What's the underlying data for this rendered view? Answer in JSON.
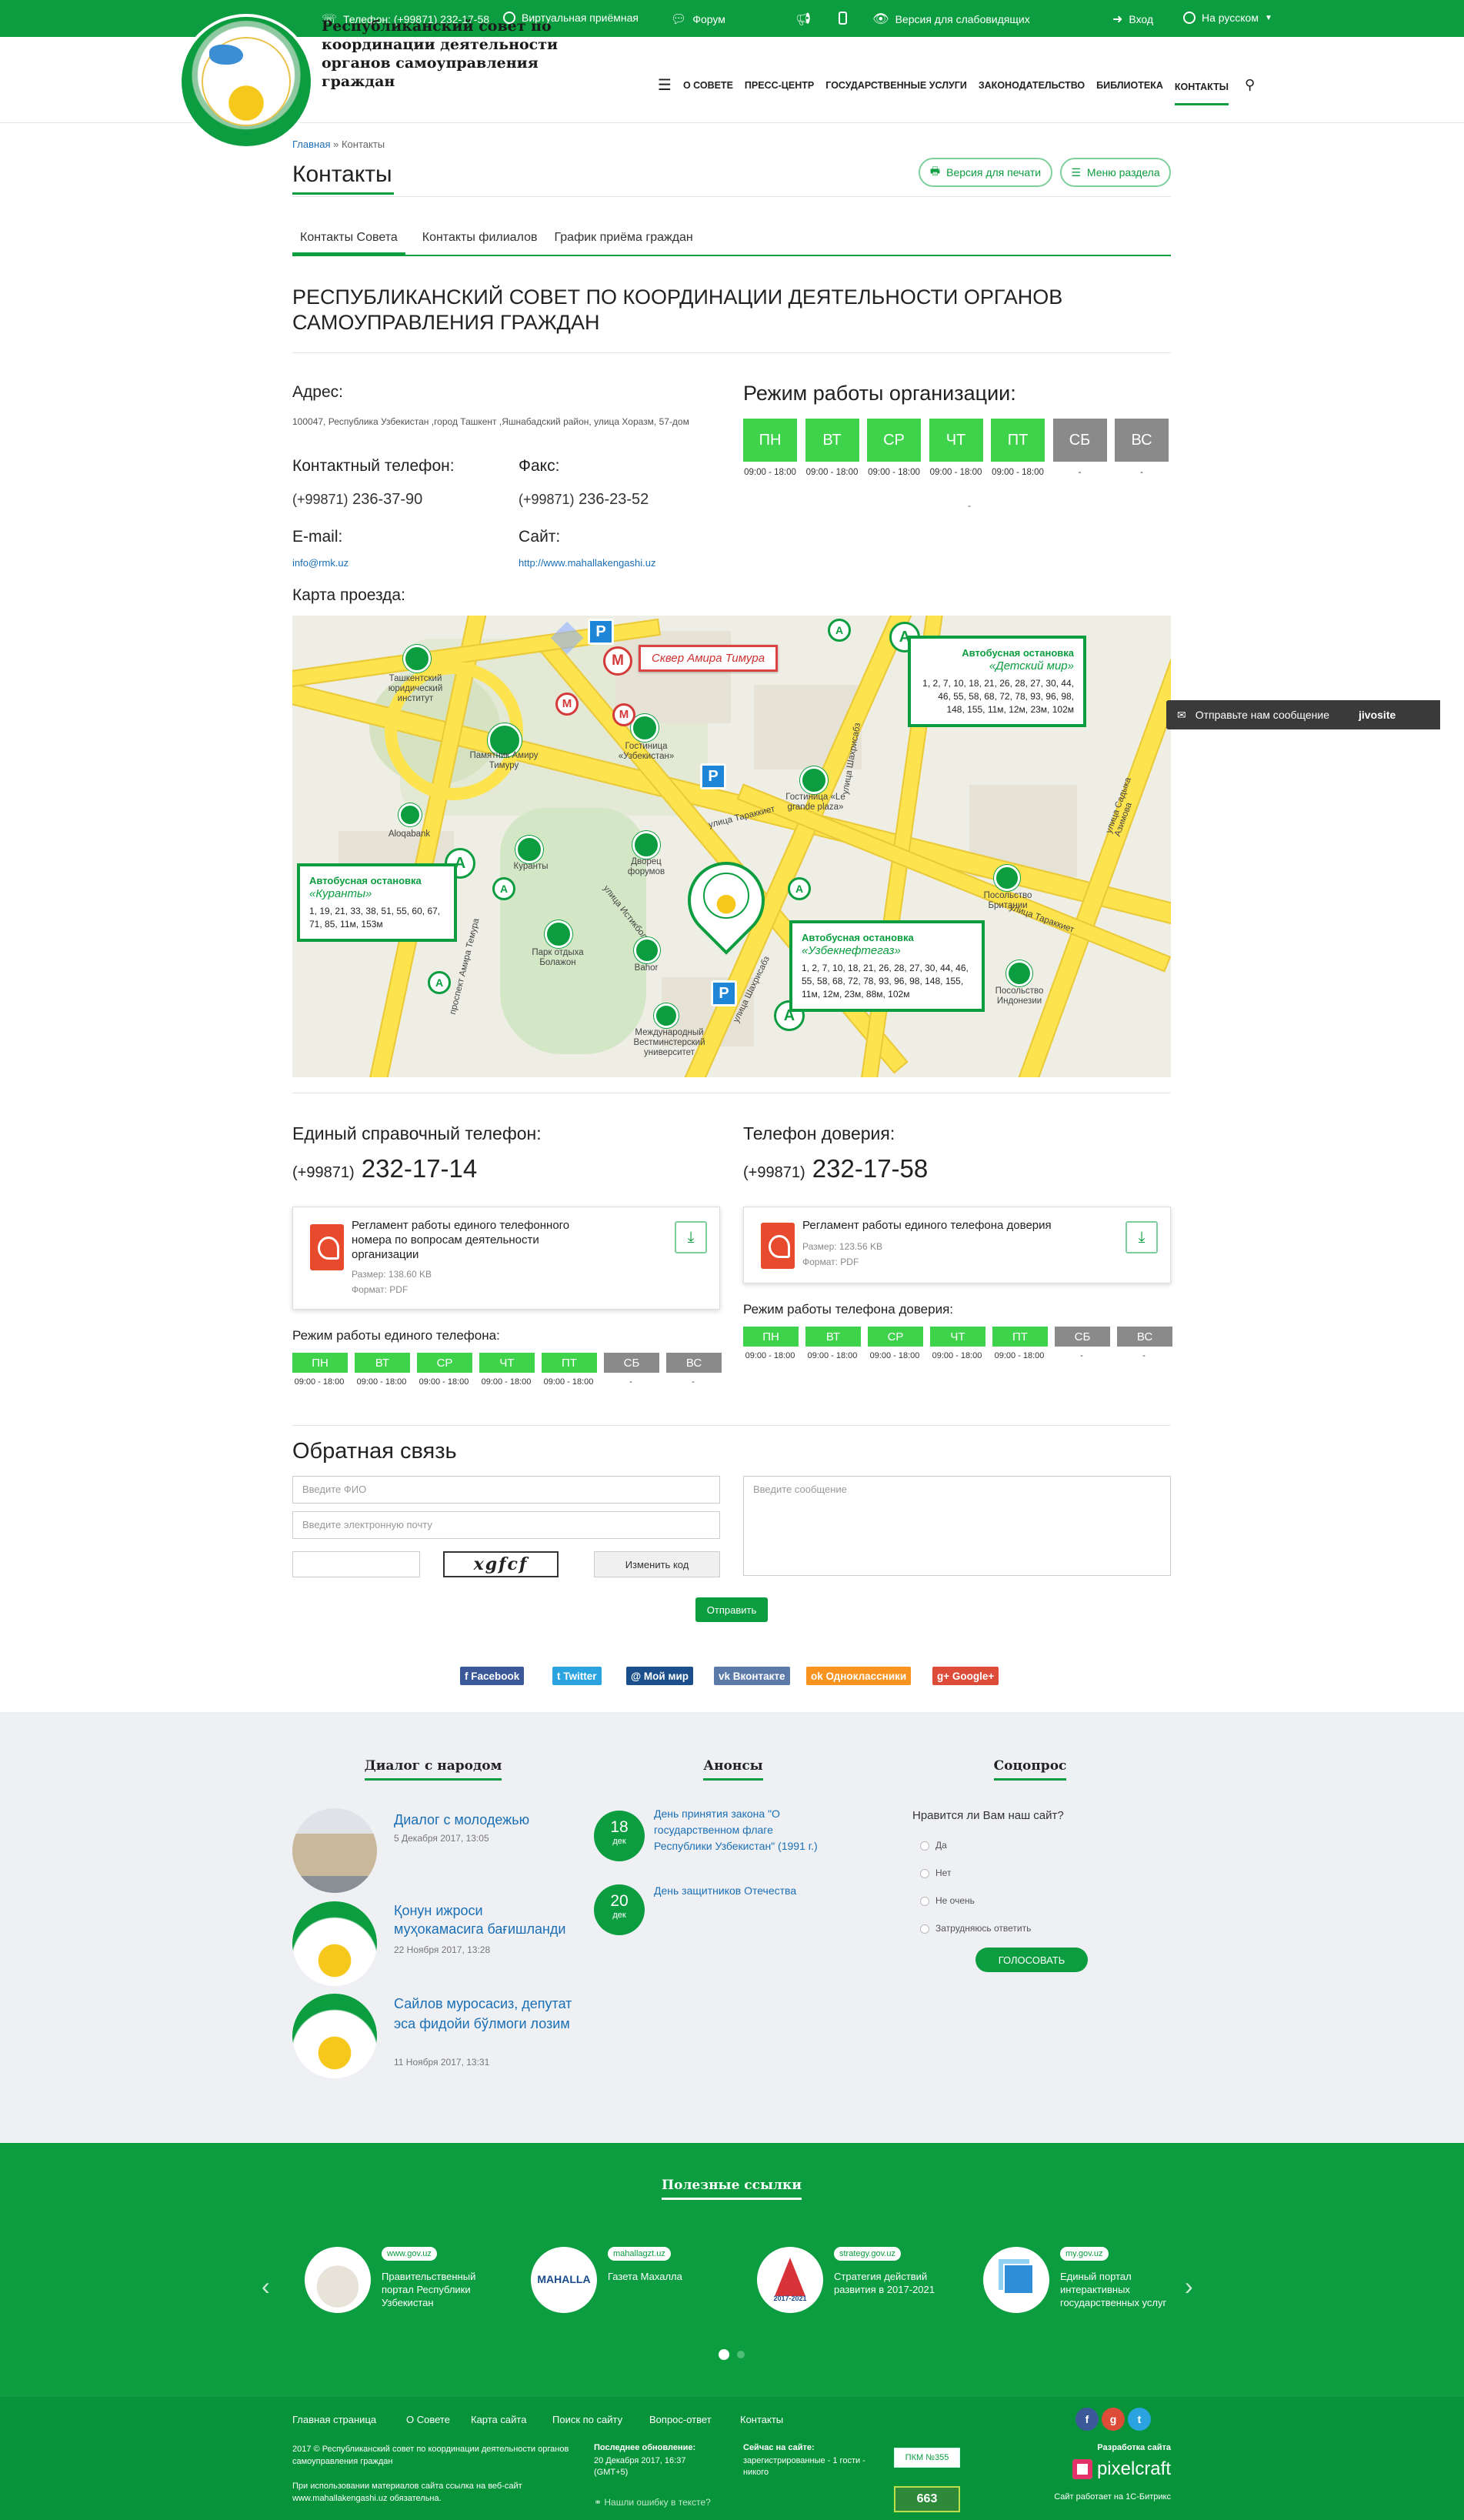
{
  "topbar": {
    "phone": "Телефон: (+99871) 232-17-58",
    "reception": "Виртуальная приёмная",
    "forum": "Форум",
    "blind": "Версия для слабовидящих",
    "login": "Вход",
    "lang": "На русском"
  },
  "header": {
    "site_name": "Республиканский совет по координации деятельности органов самоуправления граждан",
    "nav": [
      "О СОВЕТЕ",
      "ПРЕСС-ЦЕНТР",
      "ГОСУДАРСТВЕННЫЕ УСЛУГИ",
      "ЗАКОНОДАТЕЛЬСТВО",
      "БИБЛИОТЕКА",
      "КОНТАКТЫ"
    ]
  },
  "breadcrumb": {
    "home": "Главная",
    "sep": "»",
    "current": "Контакты"
  },
  "page": {
    "title": "Контакты",
    "print_btn": "Версия для печати",
    "menu_btn": "Меню раздела",
    "tabs": [
      "Контакты Совета",
      "Контакты филиалов",
      "График приёма граждан"
    ]
  },
  "org": {
    "name": "РЕСПУБЛИКАНСКИЙ СОВЕТ ПО КООРДИНАЦИИ ДЕЯТЕЛЬНОСТИ ОРГАНОВ САМОУПРАВЛЕНИЯ ГРАЖДАН",
    "address_label": "Адрес:",
    "address": "100047, Республика Узбекистан ,город Ташкент ,Яшнабадский район, улица Хоразм, 57-дом",
    "phone_label": "Контактный телефон:",
    "phone_prefix": "(+99871)",
    "phone": "236-37-90",
    "fax_label": "Факс:",
    "fax_prefix": "(+99871)",
    "fax": "236-23-52",
    "email_label": "E-mail:",
    "email": "info@rmk.uz",
    "site_label": "Сайт:",
    "site": "http://www.mahallakengashi.uz",
    "schedule_label": "Режим работы организации:",
    "days": [
      "ПН",
      "ВТ",
      "СР",
      "ЧТ",
      "ПТ",
      "СБ",
      "ВС"
    ],
    "hours": [
      "09:00 - 18:00",
      "09:00 - 18:00",
      "09:00 - 18:00",
      "09:00 - 18:00",
      "09:00 - 18:00",
      "-",
      "-"
    ],
    "extra_dash": "-"
  },
  "map": {
    "label": "Карта проезда:",
    "square": "Сквер Амира Тимура",
    "stops": [
      {
        "title": "Автобусная остановка",
        "name": "«Детский мир»",
        "routes": "1, 2, 7, 10, 18, 21, 26, 28, 27, 30, 44, 46, 55, 58, 68, 72, 78, 93, 96, 98, 148, 155, 11м, 12м, 23м, 102м"
      },
      {
        "title": "Автобусная остановка",
        "name": "«Куранты»",
        "routes": "1, 19, 21, 33, 38, 51, 55, 60, 67, 71, 85, 11м, 153м"
      },
      {
        "title": "Автобусная остановка",
        "name": "«Узбекнефтегаз»",
        "routes": "1, 2, 7, 10, 18, 21, 26, 28, 27, 30, 44, 46, 55, 58, 68, 72, 78, 93, 96, 98, 148, 155, 11м, 12м, 23м, 88м, 102м"
      }
    ],
    "places": {
      "law_institute": "Ташкентский юридический институт",
      "monument": "Памятник Амиру Тимуру",
      "hotel_uz": "Гостиница «Узбекистан»",
      "hotel_lgp": "Гостиница «Le grande plaza»",
      "aloqabank": "Aloqabank",
      "kuranty": "Куранты",
      "forums": "Дворец форумов",
      "bahor": "Bahor",
      "park": "Парк отдыха Болажон",
      "westminster": "Международный Вестминстерский университет",
      "uk_embassy": "Посольство Британии",
      "id_embassy": "Посольство Индонезии"
    },
    "streets": {
      "taraqqiyot1": "улица Тараккиет",
      "taraqqiyot2": "улица Тараккиет",
      "shahrisabz1": "улица Шахрисабз",
      "shahrisabz2": "улица Шахрисабз",
      "istiqbol": "улица Истикбол",
      "amir_temur": "проспект Амира Темура",
      "azimov": "улица Садыка Азимова"
    }
  },
  "helpline": {
    "single_label": "Единый справочный телефон:",
    "single_prefix": "(+99871)",
    "single_phone": "232-17-14",
    "trust_label": "Телефон доверия:",
    "trust_prefix": "(+99871)",
    "trust_phone": "232-17-58",
    "doc1_title": "Регламент работы единого телефонного номера по вопросам деятельности организации",
    "doc1_size": "Размер: 138.60 KB",
    "doc1_format": "Формат: PDF",
    "doc2_title": "Регламент работы единого телефона доверия",
    "doc2_size": "Размер: 123.56 KB",
    "doc2_format": "Формат: PDF",
    "single_sched": "Режим работы единого телефона:",
    "trust_sched": "Режим работы телефона доверия:"
  },
  "feedback": {
    "title": "Обратная связь",
    "name_ph": "Введите ФИО",
    "email_ph": "Введите электронную почту",
    "msg_ph": "Введите сообщение",
    "captcha": "xgfcf",
    "change_code": "Изменить код",
    "submit": "Отправить"
  },
  "widget": {
    "text": "Отправьте нам сообщение",
    "brand": "jivosite"
  },
  "share": [
    "Facebook",
    "Twitter",
    "Мой мир",
    "Вконтакте",
    "Одноклассники",
    "Google+"
  ],
  "dialog": {
    "title": "Диалог с народом",
    "items": [
      {
        "title": "Диалог с молодежью",
        "date": "5 Декабря 2017, 13:05"
      },
      {
        "title": "Қонун ижроси муҳокамасига бағишланди",
        "date": "22 Ноября 2017, 13:28"
      },
      {
        "title": "Сайлов муросасиз, депутат эса фидойи бўлмоги лозим",
        "date": "11 Ноября 2017, 13:31"
      }
    ]
  },
  "announces": {
    "title": "Анонсы",
    "items": [
      {
        "day": "18",
        "month": "дек",
        "text": "День принятия закона \"О государственном флаге Республики Узбекистан\" (1991 г.)"
      },
      {
        "day": "20",
        "month": "дек",
        "text": "День защитников Отечества"
      }
    ]
  },
  "poll": {
    "title": "Соцопрос",
    "question": "Нравится ли Вам наш сайт?",
    "options": [
      "Да",
      "Нет",
      "Не очень",
      "Затрудняюсь ответить"
    ],
    "vote": "ГОЛОСОВАТЬ"
  },
  "useful": {
    "title": "Полезные ссылки",
    "items": [
      {
        "tag": "www.gov.uz",
        "text": "Правительственный портал Республики Узбекистан"
      },
      {
        "tag": "mahallagzt.uz",
        "text": "Газета Махалла"
      },
      {
        "tag": "strategy.gov.uz",
        "text": "Стратегия действий развития в 2017-2021"
      },
      {
        "tag": "my.gov.uz",
        "text": "Единый портал интерактивных государственных услуг"
      }
    ],
    "mahalla_logo": "MAHALLA",
    "strategy_logo": "2017-2021"
  },
  "footer": {
    "links": [
      "Главная страница",
      "О Совете",
      "Карта сайта",
      "Поиск по сайту",
      "Вопрос-ответ",
      "Контакты"
    ],
    "copyright": "2017 © Республиканский совет по координации деятельности органов самоуправления граждан",
    "copy_note": "При использовании материалов сайта ссылка на веб-сайт www.mahallakengashi.uz обязательна.",
    "updated_label": "Последнее обновление:",
    "updated": "20 Декабря 2017, 16:37 (GMT+5)",
    "online_label": "Сейчас на сайте:",
    "online": "зарегистрированные - 1 гости - никого",
    "error_link": "Нашли ошибку в тексте?",
    "pkm": "ПКМ №355",
    "counter": "663",
    "dev_label": "Разработка сайта",
    "dev": "pixelcraft",
    "cms": "Сайт работает на 1С-Битрикс"
  },
  "colors": {
    "primary": "#0b9d3f",
    "day_active": "#3fd34c",
    "day_off": "#8a8a8a",
    "link": "#1b6fb5"
  }
}
